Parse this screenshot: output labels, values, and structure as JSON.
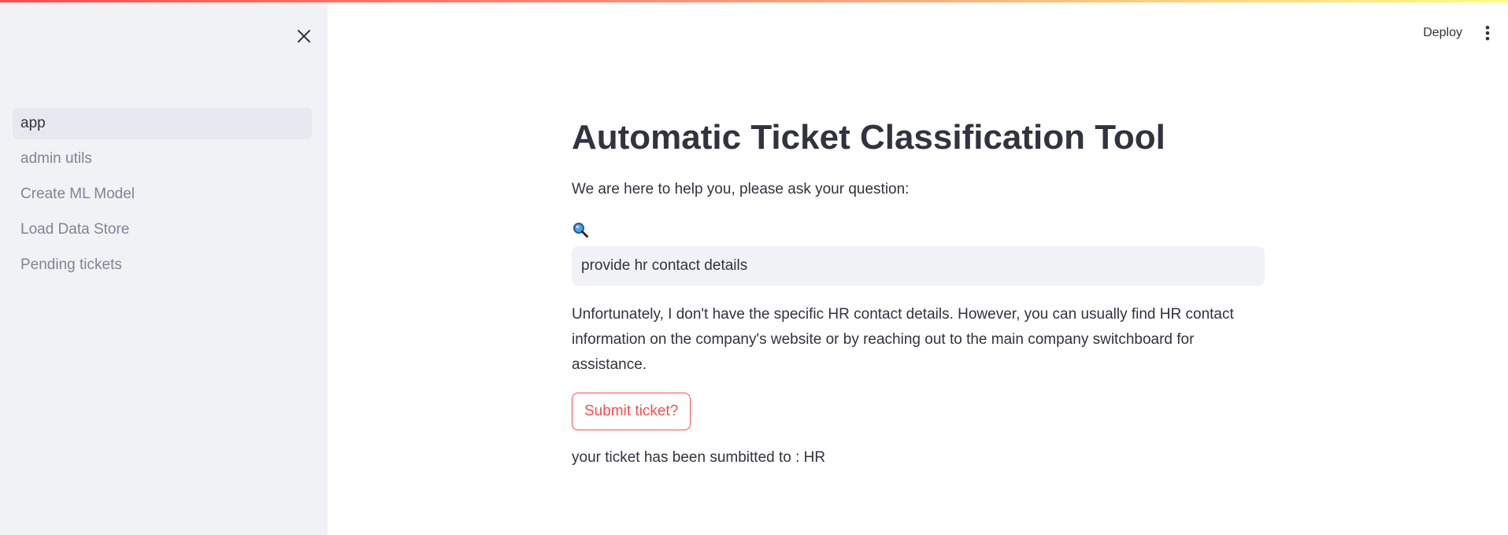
{
  "sidebar": {
    "close_icon": "close-icon",
    "items": [
      {
        "label": "app",
        "active": true
      },
      {
        "label": "admin utils",
        "active": false
      },
      {
        "label": "Create ML Model",
        "active": false
      },
      {
        "label": "Load Data Store",
        "active": false
      },
      {
        "label": "Pending tickets",
        "active": false
      }
    ]
  },
  "header": {
    "deploy_label": "Deploy",
    "menu_icon": "more-vertical-icon"
  },
  "main": {
    "title": "Automatic Ticket Classification Tool",
    "intro": "We are here to help you, please ask your question:",
    "search_icon": "magnifying-glass-icon",
    "query_value": "provide hr contact details",
    "answer": "Unfortunately, I don't have the specific HR contact details. However, you can usually find HR contact information on the company's website or by reaching out to the main company switchboard for assistance.",
    "submit_label": "Submit ticket?",
    "status": "your ticket has been sumbitted to : HR"
  },
  "colors": {
    "accent": "#ff4b4b",
    "sidebar_bg": "#f0f2f6",
    "text": "#31333f",
    "muted_text": "#808495"
  }
}
